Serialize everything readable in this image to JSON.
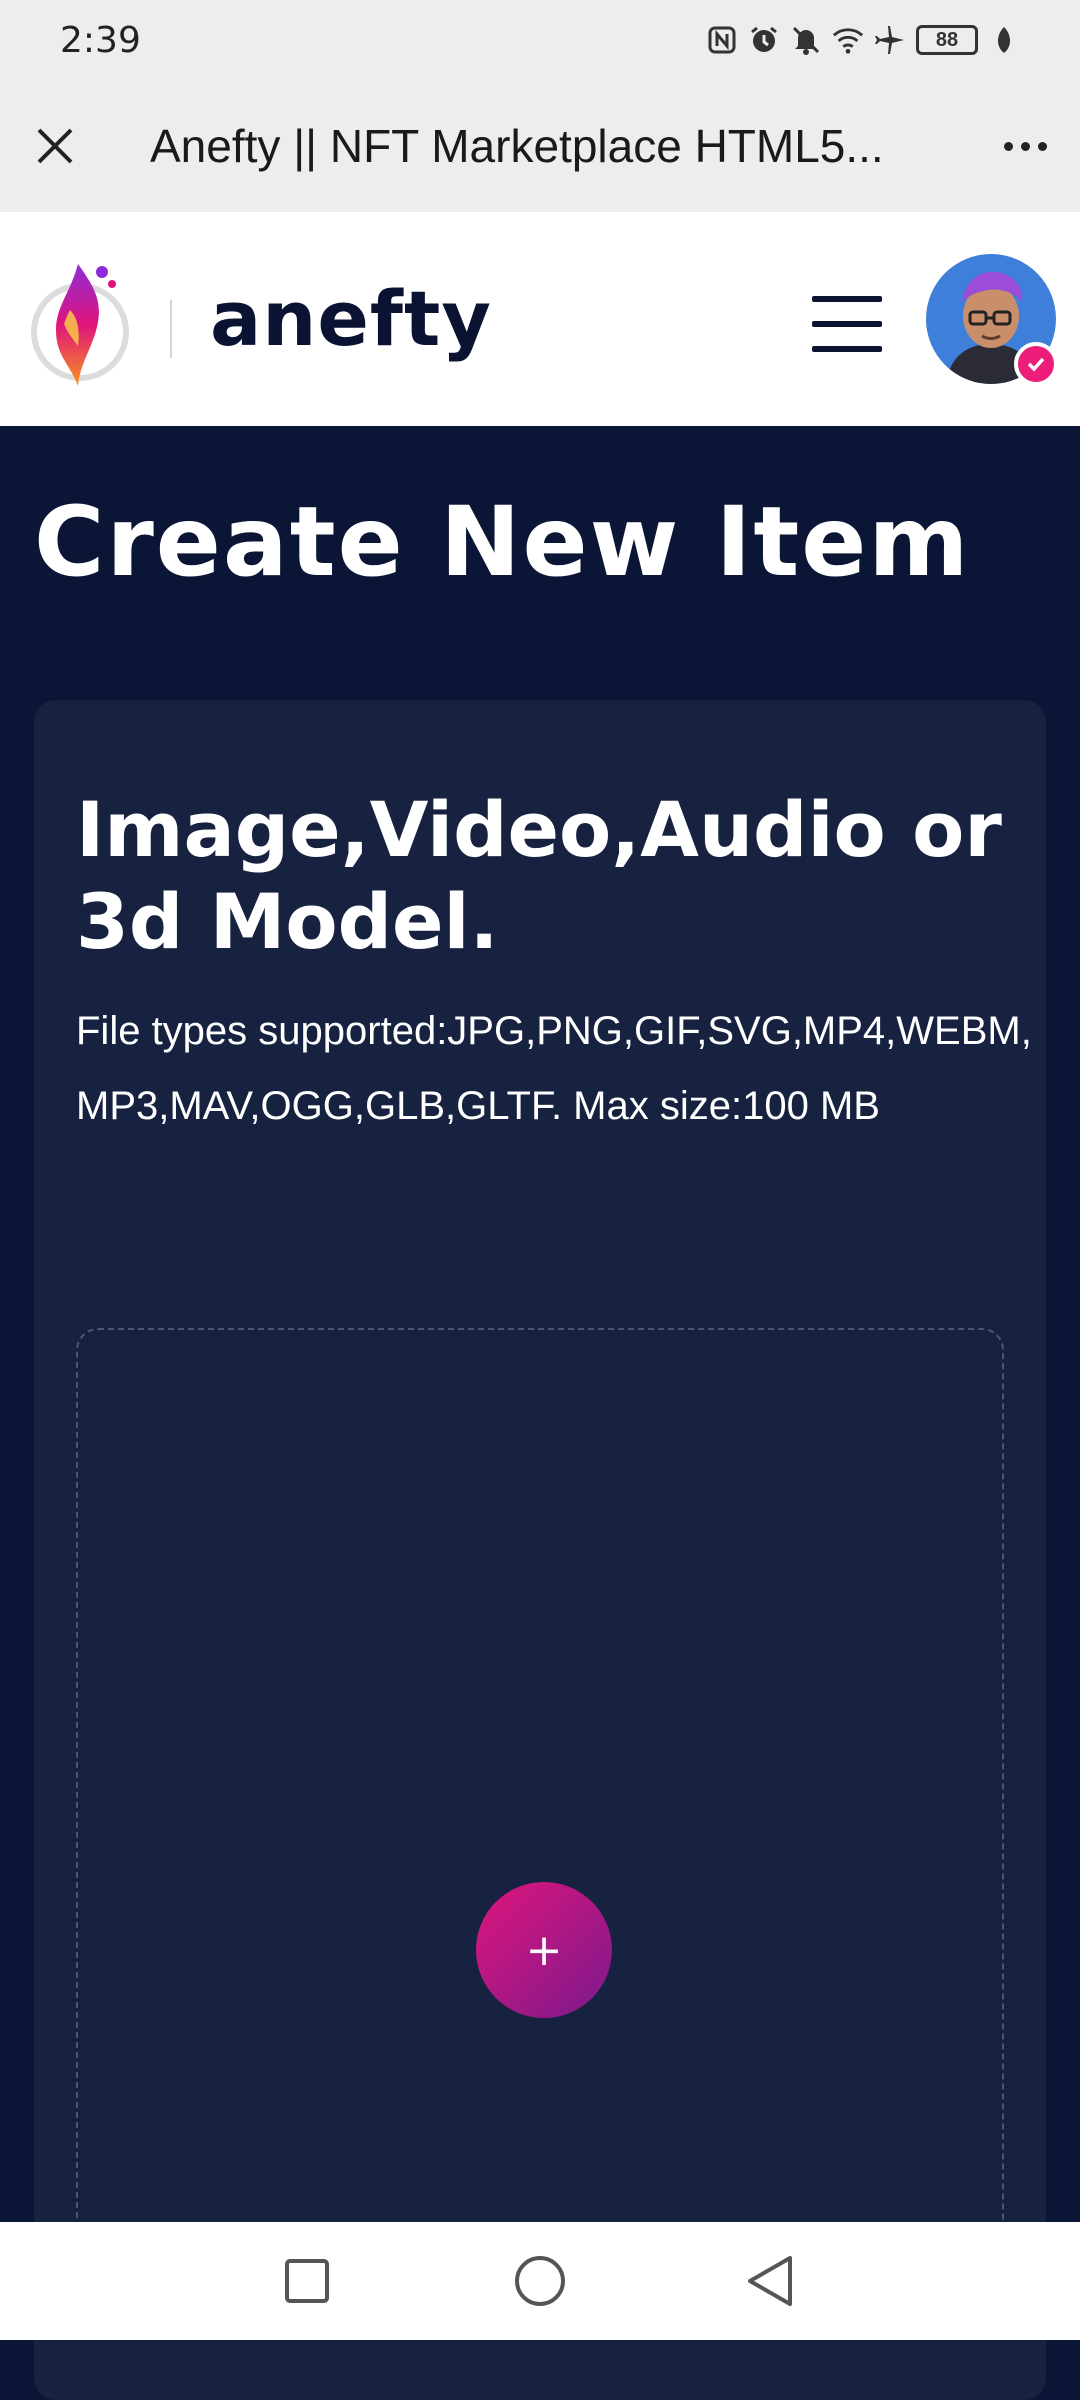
{
  "status_bar": {
    "time": "2:39",
    "battery": "88",
    "icons": [
      "nfc-icon",
      "alarm-icon",
      "mute-icon",
      "wifi-icon",
      "airplane-icon",
      "battery-icon",
      "leaf-icon"
    ]
  },
  "browser": {
    "title": "Anefty || NFT Marketplace HTML5...",
    "close_icon": "close-icon",
    "more_icon": "more-icon"
  },
  "header": {
    "logo_text": "anefty",
    "menu_icon": "hamburger-icon",
    "avatar_icon": "avatar"
  },
  "main": {
    "heading": "Create New Item",
    "card": {
      "title": "Image,Video,Audio or 3d Model.",
      "description": "File types supported:JPG,PNG,GIF,SVG,MP4,WEBM,MP3,MAV,OGG,GLB,GLTF. Max size:100 MB",
      "upload_label": "+"
    }
  },
  "nav": {
    "recents_icon": "square-icon",
    "home_icon": "circle-icon",
    "back_icon": "triangle-back-icon"
  },
  "colors": {
    "background": "#0b1636",
    "card": "#16223f",
    "accent": "#e0157c",
    "accent2": "#7a1a8c"
  }
}
